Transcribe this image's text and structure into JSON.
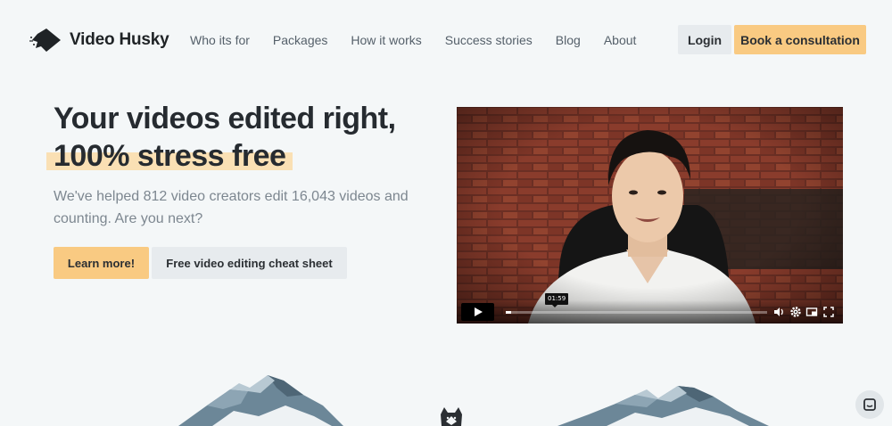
{
  "brand": {
    "name": "Video Husky"
  },
  "nav": {
    "links": [
      "Who its for",
      "Packages",
      "How it works",
      "Success stories",
      "Blog",
      "About"
    ],
    "login_label": "Login",
    "consult_label": "Book a consultation"
  },
  "hero": {
    "title_line1": "Your videos edited right,",
    "title_line2": "100% stress free",
    "subtitle": "We've helped 812 video creators edit 16,043 videos and counting. Are you next?",
    "learn_label": "Learn more!",
    "cheat_label": "Free video editing cheat sheet"
  },
  "video": {
    "time_tooltip": "01:59",
    "progress": 0.02,
    "icons": [
      "play-icon",
      "volume-icon",
      "settings-icon",
      "pip-icon",
      "fullscreen-icon"
    ]
  },
  "colors": {
    "accent": "#f9ca82",
    "highlight": "#fae0b4",
    "background": "#f4f7f8",
    "secondary_button": "#e7ebee"
  }
}
